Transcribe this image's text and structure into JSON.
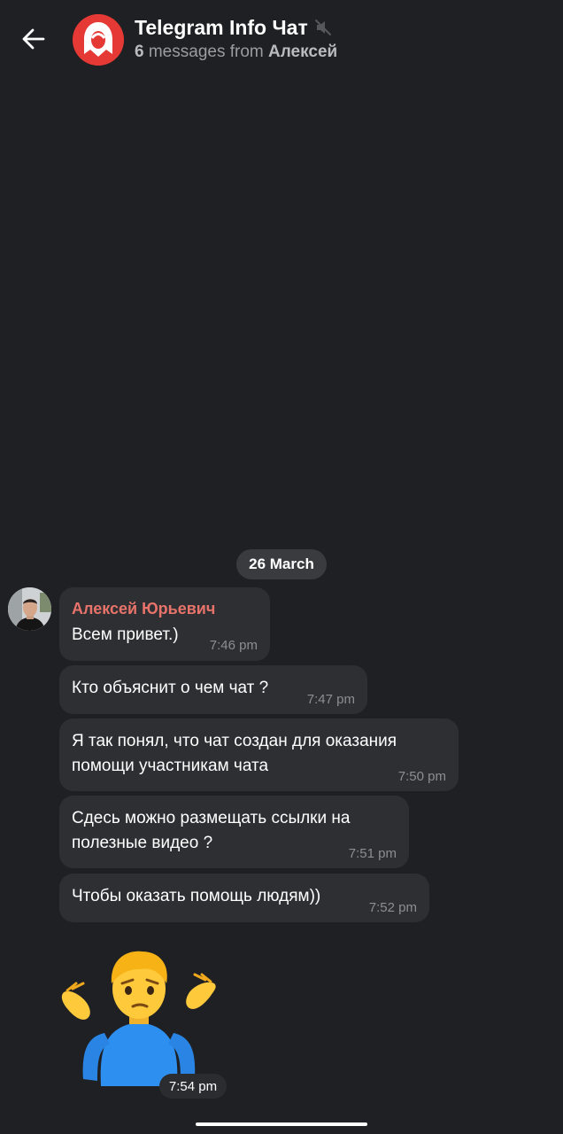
{
  "header": {
    "back_icon": "arrow-left-icon",
    "avatar_icon": "telegram-info-logo",
    "title": "Telegram Info Чат",
    "muted_icon": "speaker-muted-icon",
    "subtitle_count": "6",
    "subtitle_middle": "messages from",
    "subtitle_sender": "Алексей"
  },
  "date_divider": "26 March",
  "messages": [
    {
      "sender": "Алексей Юрьевич",
      "lines": [
        "Всем привет.)"
      ],
      "time": "7:46 pm"
    },
    {
      "lines": [
        "Кто объяснит о чем чат ?"
      ],
      "time": "7:47 pm"
    },
    {
      "lines": [
        "Я так понял, что чат создан для оказания",
        "помощи участникам чата"
      ],
      "time": "7:50 pm"
    },
    {
      "lines": [
        "Сдесь можно размещать ссылки на",
        "полезные видео ?"
      ],
      "time": "7:51 pm"
    },
    {
      "lines": [
        "Чтобы оказать помощь людям))"
      ],
      "time": "7:52 pm"
    }
  ],
  "sticker": {
    "icon": "man-shrugging-sticker",
    "time": "7:54 pm"
  },
  "colors": {
    "background": "#1f2023",
    "bubble": "#2e2f32",
    "sender_name": "#e8736a",
    "channel_avatar": "#e53935"
  }
}
